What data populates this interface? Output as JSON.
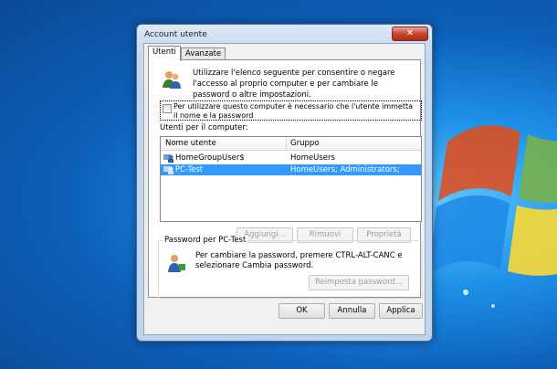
{
  "window": {
    "title": "Account utente",
    "close_glyph": "✕"
  },
  "tabs": [
    {
      "label": "Utenti",
      "active": true
    },
    {
      "label": "Avanzate",
      "active": false
    }
  ],
  "intro_text": "Utilizzare l'elenco seguente per consentire o negare l'accesso al proprio computer e per cambiare le password o altre impostazioni.",
  "require_login_checkbox": {
    "label": "Per utilizzare questo computer è necessario che l'utente immetta il nome e la password",
    "checked": false
  },
  "users_list": {
    "label": "Utenti per il computer:",
    "columns": [
      "Nome utente",
      "Gruppo"
    ],
    "rows": [
      {
        "name": "HomeGroupUser$",
        "group": "HomeUsers",
        "selected": false
      },
      {
        "name": "PC-Test",
        "group": "HomeUsers; Administrators; Users",
        "selected": true
      }
    ]
  },
  "list_buttons": {
    "add": "Aggiungi...",
    "remove": "Rimuovi",
    "properties": "Proprietà"
  },
  "password_group": {
    "title": "Password per PC-Test",
    "text": "Per cambiare la password, premere CTRL-ALT-CANC e selezionare Cambia password.",
    "reset_button": "Reimposta password..."
  },
  "footer_buttons": {
    "ok": "OK",
    "cancel": "Annulla",
    "apply": "Applica"
  },
  "icons": {
    "users": "users-icon",
    "user": "user-icon",
    "close": "close-icon"
  },
  "colors": {
    "selection": "#3399ff",
    "desktop": "#1e8fe6"
  }
}
